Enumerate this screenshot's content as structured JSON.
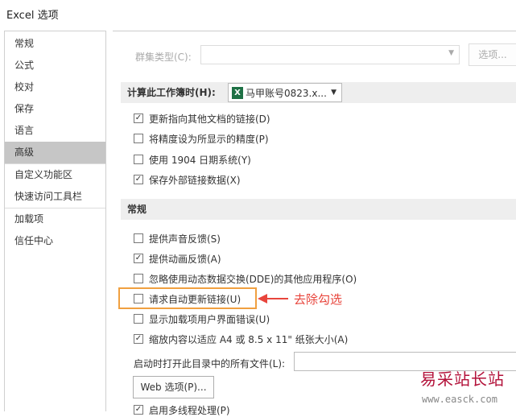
{
  "window": {
    "title": "Excel 选项"
  },
  "sidebar": {
    "items": [
      {
        "label": "常规"
      },
      {
        "label": "公式"
      },
      {
        "label": "校对"
      },
      {
        "label": "保存"
      },
      {
        "label": "语言"
      },
      {
        "label": "高级",
        "selected": true
      },
      {
        "label": "自定义功能区"
      },
      {
        "label": "快速访问工具栏"
      },
      {
        "label": "加载项"
      },
      {
        "label": "信任中心"
      }
    ]
  },
  "cluster": {
    "label": "群集类型(C):",
    "value": "",
    "options_button": "选项..."
  },
  "calc_section": {
    "label": "计算此工作簿时(H):",
    "workbook": "马甲账号0823.x...",
    "options": [
      {
        "label": "更新指向其他文档的链接(D)",
        "checked": true
      },
      {
        "label": "将精度设为所显示的精度(P)",
        "checked": false
      },
      {
        "label": "使用 1904 日期系统(Y)",
        "checked": false
      },
      {
        "label": "保存外部链接数据(X)",
        "checked": true
      }
    ]
  },
  "general_section": {
    "label": "常规",
    "options": [
      {
        "label": "提供声音反馈(S)",
        "checked": false
      },
      {
        "label": "提供动画反馈(A)",
        "checked": true
      },
      {
        "label": "忽略使用动态数据交换(DDE)的其他应用程序(O)",
        "checked": false
      },
      {
        "label": "请求自动更新链接(U)",
        "checked": false
      },
      {
        "label": "显示加载项用户界面错误(U)",
        "checked": false
      },
      {
        "label": "缩放内容以适应 A4 或 8.5 x 11\" 纸张大小(A)",
        "checked": true
      }
    ],
    "startup_label": "启动时打开此目录中的所有文件(L):",
    "startup_value": "",
    "web_button": "Web 选项(P)...",
    "multithread": {
      "label": "启用多线程处理(P)",
      "checked": true
    }
  },
  "annotation": {
    "text": "去除勾选",
    "color": "#e8453c",
    "box_color": "#f0a040"
  },
  "watermark": {
    "text": "易采站长站",
    "url": "www.easck.com"
  }
}
